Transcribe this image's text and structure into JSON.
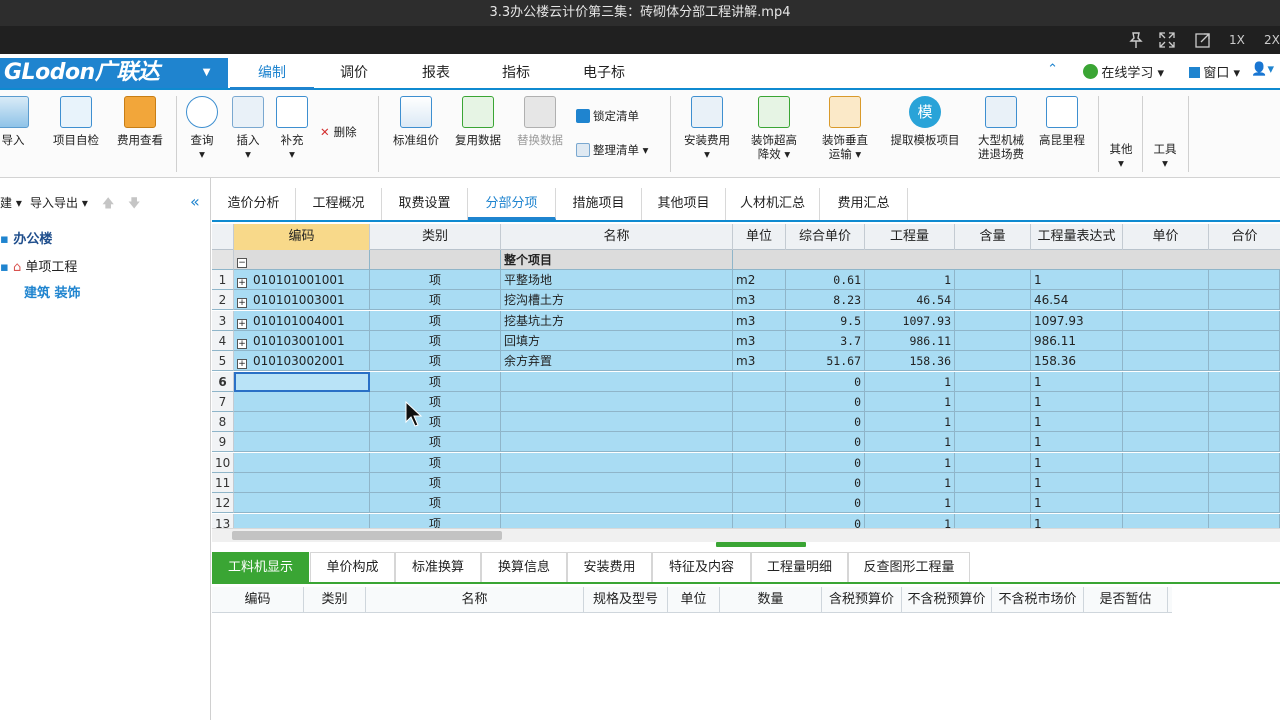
{
  "player": {
    "title": "3.3办公楼云计价第三集：砖砌体分部工程讲解.mp4",
    "speed_1x": "1X",
    "speed_2x": "2X"
  },
  "menubar": {
    "logo": "GLodon广联达",
    "tabs": [
      "编制",
      "调价",
      "报表",
      "指标",
      "电子标"
    ],
    "active_tab": "编制",
    "online_learning": "在线学习",
    "window": "窗口"
  },
  "ribbon": {
    "import": "导入",
    "self_check": "项目自检",
    "fee_view": "费用查看",
    "query": "查询",
    "insert": "插入",
    "supplement": "补充",
    "delete": "删除",
    "std_group": "标准组价",
    "reuse_data": "复用数据",
    "replace_data": "替换数据",
    "lock_list": "锁定清单",
    "tidy_list": "整理清单",
    "install_fee": "安装费用",
    "deco_height_1": "装饰超高",
    "deco_height_2": "降效",
    "deco_vertical_1": "装饰垂直",
    "deco_vertical_2": "运输",
    "template_item": "提取模板项目",
    "template_glyph": "模",
    "machine_1": "大型机械",
    "machine_2": "进退场费",
    "elevation": "高昆里程",
    "other": "其他",
    "tools": "工具"
  },
  "leftpanel": {
    "new": "建",
    "import_export": "导入导出",
    "tree_root": "办公楼",
    "tree_child": "单项工程",
    "tree_leaf": "建筑 装饰"
  },
  "tabs": [
    "造价分析",
    "工程概况",
    "取费设置",
    "分部分项",
    "措施项目",
    "其他项目",
    "人材机汇总",
    "费用汇总"
  ],
  "active_tab": "分部分项",
  "grid": {
    "headers": [
      "编码",
      "类别",
      "名称",
      "单位",
      "综合单价",
      "工程量",
      "含量",
      "工程量表达式",
      "单价",
      "合价"
    ],
    "summary_row": "整个项目",
    "rows": [
      {
        "no": "1",
        "code": "010101001001",
        "type": "项",
        "name": "平整场地",
        "unit": "m2",
        "price": "0.61",
        "qty": "1",
        "expr": "1"
      },
      {
        "no": "2",
        "code": "010101003001",
        "type": "项",
        "name": "挖沟槽土方",
        "unit": "m3",
        "price": "8.23",
        "qty": "46.54",
        "expr": "46.54"
      },
      {
        "no": "3",
        "code": "010101004001",
        "type": "项",
        "name": "挖基坑土方",
        "unit": "m3",
        "price": "9.5",
        "qty": "1097.93",
        "expr": "1097.93"
      },
      {
        "no": "4",
        "code": "010103001001",
        "type": "项",
        "name": "回填方",
        "unit": "m3",
        "price": "3.7",
        "qty": "986.11",
        "expr": "986.11"
      },
      {
        "no": "5",
        "code": "010103002001",
        "type": "项",
        "name": "余方弃置",
        "unit": "m3",
        "price": "51.67",
        "qty": "158.36",
        "expr": "158.36"
      },
      {
        "no": "6",
        "code": "",
        "type": "项",
        "name": "",
        "unit": "",
        "price": "0",
        "qty": "1",
        "expr": "1"
      },
      {
        "no": "7",
        "code": "",
        "type": "项",
        "name": "",
        "unit": "",
        "price": "0",
        "qty": "1",
        "expr": "1"
      },
      {
        "no": "8",
        "code": "",
        "type": "项",
        "name": "",
        "unit": "",
        "price": "0",
        "qty": "1",
        "expr": "1"
      },
      {
        "no": "9",
        "code": "",
        "type": "项",
        "name": "",
        "unit": "",
        "price": "0",
        "qty": "1",
        "expr": "1"
      },
      {
        "no": "10",
        "code": "",
        "type": "项",
        "name": "",
        "unit": "",
        "price": "0",
        "qty": "1",
        "expr": "1"
      },
      {
        "no": "11",
        "code": "",
        "type": "项",
        "name": "",
        "unit": "",
        "price": "0",
        "qty": "1",
        "expr": "1"
      },
      {
        "no": "12",
        "code": "",
        "type": "项",
        "name": "",
        "unit": "",
        "price": "0",
        "qty": "1",
        "expr": "1"
      },
      {
        "no": "13",
        "code": "",
        "type": "项",
        "name": "",
        "unit": "",
        "price": "0",
        "qty": "1",
        "expr": "1"
      }
    ]
  },
  "bottom": {
    "tabs": [
      "工料机显示",
      "单价构成",
      "标准换算",
      "换算信息",
      "安装费用",
      "特征及内容",
      "工程量明细",
      "反查图形工程量"
    ],
    "active_tab": "工料机显示",
    "headers": [
      "编码",
      "类别",
      "名称",
      "规格及型号",
      "单位",
      "数量",
      "含税预算价",
      "不含税预算价",
      "不含税市场价",
      "是否暂估"
    ]
  },
  "colors": {
    "brand_blue": "#1f84cf",
    "row_blue": "#a9dcf3",
    "header_yellow": "#f8d98a",
    "green": "#3aa534"
  }
}
